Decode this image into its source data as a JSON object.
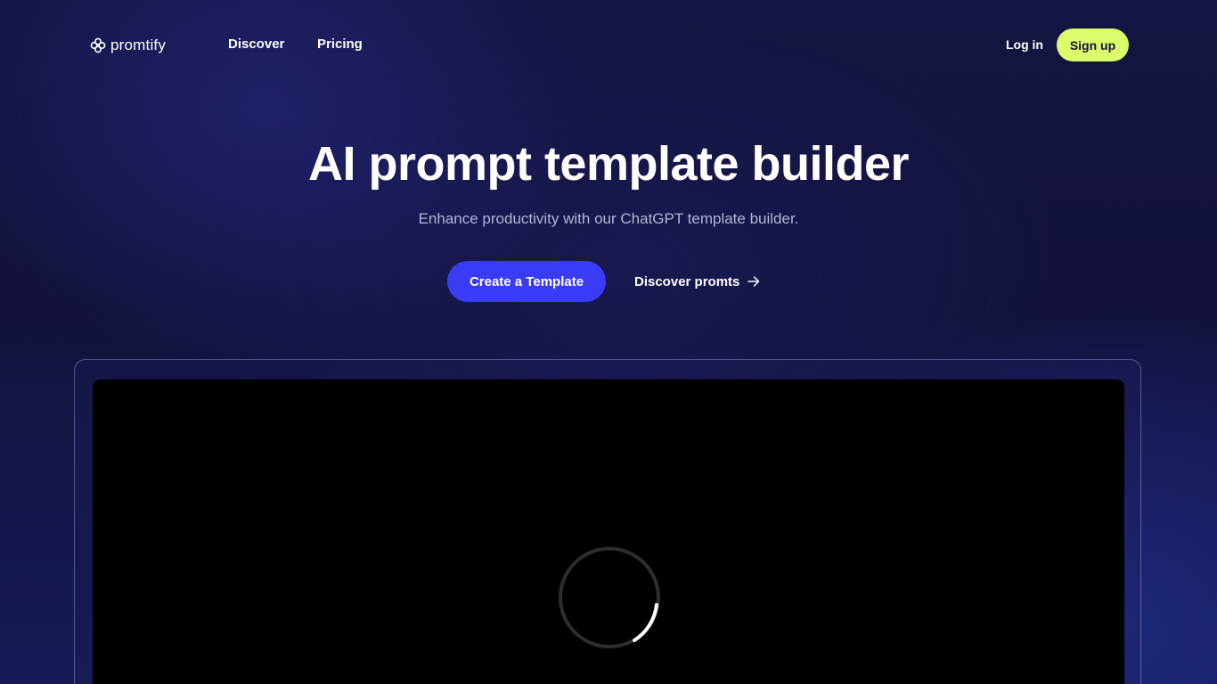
{
  "nav": {
    "logo_text": "promtify",
    "links": [
      "Discover",
      "Pricing"
    ],
    "login_label": "Log in",
    "signup_label": "Sign up"
  },
  "hero": {
    "title": "AI prompt template builder",
    "subtitle": "Enhance productivity with our ChatGPT template builder.",
    "primary_cta": "Create a Template",
    "secondary_cta": "Discover promts"
  },
  "video": {
    "state": "loading",
    "spinner_icon": "loading-spinner-icon"
  },
  "colors": {
    "background": "#12123c",
    "accent_primary": "#3a3cf5",
    "accent_signup": "#dcfc6a",
    "subtitle_text": "#b4b5d6",
    "video_bg": "#000000"
  }
}
